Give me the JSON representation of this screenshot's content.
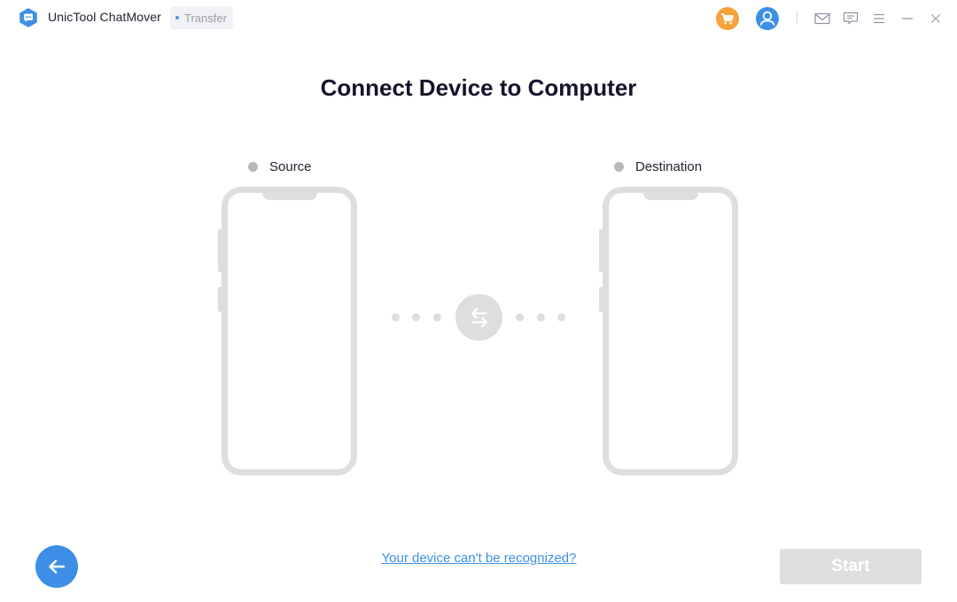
{
  "app": {
    "name": "UnicTool ChatMover",
    "mode": "Transfer",
    "logo_icon": "chat-bubble-hexagon-icon"
  },
  "titlebar": {
    "icons": [
      "cart-icon",
      "user-icon",
      "mail-icon",
      "feedback-icon",
      "menu-icon",
      "minimize-icon",
      "close-icon"
    ]
  },
  "colors": {
    "accent": "#3d8fe6",
    "cart": "#f9a13a",
    "placeholder_gray": "#dedede",
    "status_dot": "#b8b8b8",
    "disabled_button": "#dedee0"
  },
  "main": {
    "title": "Connect Device to Computer",
    "source_label": "Source",
    "destination_label": "Destination",
    "swap_icon": "swap-arrows-icon"
  },
  "footer": {
    "help_link": "Your device can't be recognized?",
    "start_label": "Start",
    "start_enabled": false
  }
}
